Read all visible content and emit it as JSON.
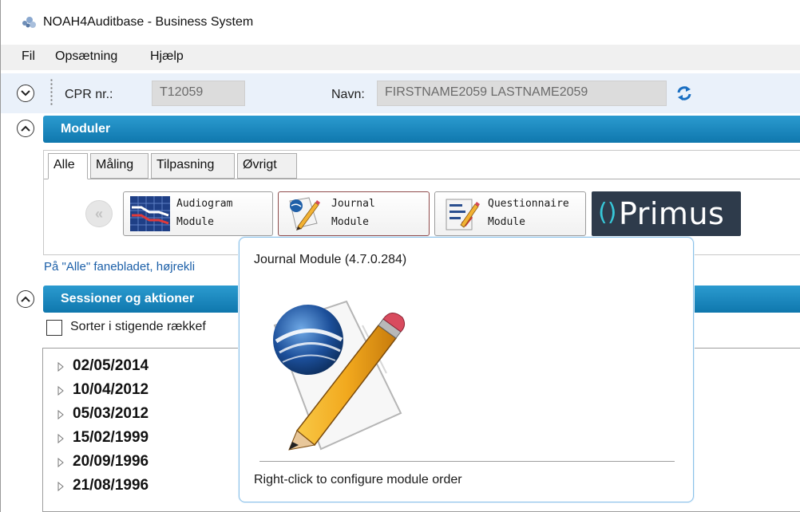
{
  "window": {
    "title": "NOAH4Auditbase - Business System"
  },
  "menu": {
    "items": [
      "Fil",
      "Opsætning",
      "Hjælp"
    ]
  },
  "patient": {
    "cpr_label": "CPR nr.:",
    "cpr_value": "T12059",
    "name_label": "Navn:",
    "name_value": "FIRSTNAME2059 LASTNAME2059"
  },
  "modules": {
    "header": "Moduler",
    "tabs": [
      "Alle",
      "Måling",
      "Tilpasning",
      "Øvrigt"
    ],
    "active_tab": "Alle",
    "nav_back_symbol": "«",
    "buttons": [
      {
        "line1": "Audiogram",
        "line2": "Module",
        "icon": "audiogram-icon"
      },
      {
        "line1": "Journal",
        "line2": "Module",
        "icon": "journal-icon"
      },
      {
        "line1": "Questionnaire",
        "line2": "Module",
        "icon": "questionnaire-icon"
      }
    ],
    "primus": {
      "mark": "()",
      "text": "Primus"
    },
    "hint": "På \"Alle\" fanebladet, højrekli"
  },
  "sessions": {
    "header": "Sessioner og aktioner",
    "sort_label": "Sorter i stigende rækkef",
    "dates": [
      "02/05/2014",
      "10/04/2012",
      "05/03/2012",
      "15/02/1999",
      "20/09/1996",
      "21/08/1996"
    ]
  },
  "tooltip": {
    "title": "Journal Module (4.7.0.284)",
    "footer": "Right-click to configure module order"
  },
  "colors": {
    "section_header": "#1a8ac2",
    "accent_blue": "#1b5fa8",
    "primus_bg": "#2e3b4b",
    "primus_mark": "#37c8d9"
  }
}
